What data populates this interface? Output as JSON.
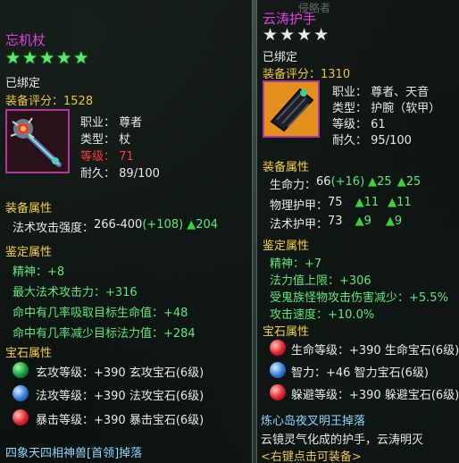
{
  "colors": {
    "item_name": "#e040e0",
    "section": "#f4d03f",
    "green_stat": "#5ee67a",
    "red_level": "#ff3a3a",
    "frame": "#b0389b"
  },
  "left": {
    "title": "忘机杖",
    "star_count": 5,
    "bound": "已绑定",
    "score_label": "装备评分：",
    "score_value": "1528",
    "info": [
      {
        "label": "职业：",
        "value": "尊者"
      },
      {
        "label": "类型：",
        "value": "杖"
      },
      {
        "label": "等级：",
        "value": "71"
      },
      {
        "label": "耐久：",
        "value": "89/100"
      }
    ],
    "equip_attr_header": "装备属性",
    "equip_attr": {
      "label": "法术攻击强度：",
      "base": "266-400",
      "bonus": "(+108)",
      "arrow_value": "204"
    },
    "ident_header": "鉴定属性",
    "ident_attrs": [
      "精神：+8",
      "最大法术攻击力：+316",
      "命中有几率吸取目标生命值：+48",
      "命中有几率减少目标法力值：+284"
    ],
    "gem_header": "宝石属性",
    "gems": [
      {
        "icon": "jade-gem-icon",
        "text": "玄攻等级：+390 玄攻宝石(6级)"
      },
      {
        "icon": "blue-gem-icon",
        "text": "法攻等级：+390 法攻宝石(6级)"
      },
      {
        "icon": "red-gem-icon",
        "text": "暴击等级：+390 暴击宝石(6级)"
      }
    ],
    "drop": "四象天四相神兽[首领]掉落"
  },
  "right": {
    "top_faded": "侵略者",
    "title": "云涛护手",
    "star_count": 4,
    "bound": "已绑定",
    "score_label": "装备评分：",
    "score_value": "1310",
    "info": [
      {
        "label": "职业：",
        "value": "尊者、天音"
      },
      {
        "label": "类型：",
        "value": "护腕（软甲）"
      },
      {
        "label": "等级：",
        "value": "61"
      },
      {
        "label": "耐久：",
        "value": "95/100"
      }
    ],
    "equip_attr_header": "装备属性",
    "equip_attrs": [
      {
        "label": "生命力：",
        "base": "66",
        "bonus": "(+16)",
        "a1": "25",
        "a2": "25"
      },
      {
        "label": "物理护甲：",
        "base": "75",
        "bonus": "",
        "a1": "11",
        "a2": "11"
      },
      {
        "label": "法术护甲：",
        "base": "73",
        "bonus": "",
        "a1": "9",
        "a2": "9"
      }
    ],
    "ident_header": "鉴定属性",
    "ident_attrs": [
      "精神：+7",
      "法力值上限：+306",
      "受鬼族怪物攻击伤害减少：+5.5%",
      "攻击速度：+10.0%"
    ],
    "gem_header": "宝石属性",
    "gems": [
      {
        "icon": "red-gem-icon",
        "text": "生命等级：+390 生命宝石(6级)"
      },
      {
        "icon": "blue-gem-icon",
        "text": "智力：+46 智力宝石(6级)"
      },
      {
        "icon": "red-gem-icon",
        "text": "躲避等级：+390 躲避宝石(6级)"
      }
    ],
    "drop": "炼心岛夜叉明王掉落",
    "description": "云镜灵气化成的护手，云涛明灭",
    "hint": "<右键点击可装备>"
  }
}
